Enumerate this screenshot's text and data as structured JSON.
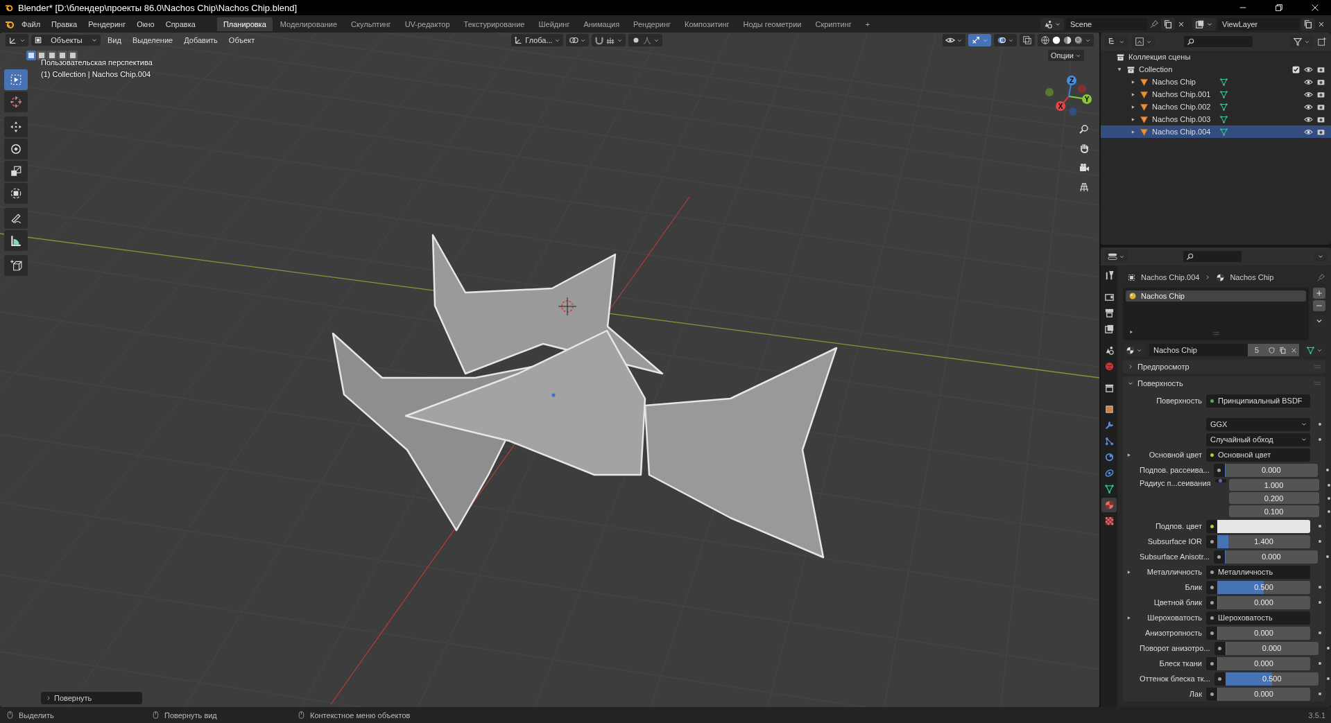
{
  "window": {
    "title": "Blender* [D:\\блендер\\проекты 86.0\\Nachos Chip\\Nachos Chip.blend]"
  },
  "menu_bar": {
    "menus": [
      "Файл",
      "Правка",
      "Рендеринг",
      "Окно",
      "Справка"
    ],
    "workspaces": [
      {
        "label": "Планировка",
        "selected": true
      },
      {
        "label": "Моделирование",
        "selected": false
      },
      {
        "label": "Скульптинг",
        "selected": false
      },
      {
        "label": "UV-редактор",
        "selected": false
      },
      {
        "label": "Текстурирование",
        "selected": false
      },
      {
        "label": "Шейдинг",
        "selected": false
      },
      {
        "label": "Анимация",
        "selected": false
      },
      {
        "label": "Рендеринг",
        "selected": false
      },
      {
        "label": "Композитинг",
        "selected": false
      },
      {
        "label": "Ноды геометрии",
        "selected": false
      },
      {
        "label": "Скриптинг",
        "selected": false
      }
    ],
    "add_tab": "+",
    "scene": "Scene",
    "view_layer": "ViewLayer"
  },
  "viewport_header": {
    "mode": "Объекты",
    "menus": [
      "Вид",
      "Выделение",
      "Добавить",
      "Объект"
    ],
    "orientation": "Глоба...",
    "options": "Опции",
    "select_modes": [
      {
        "selected": true
      },
      {
        "selected": false
      },
      {
        "selected": false
      },
      {
        "selected": false
      },
      {
        "selected": false
      }
    ]
  },
  "viewport": {
    "overlay_lines": [
      "Пользовательская перспектива",
      "(1) Collection | Nachos Chip.004"
    ],
    "tools": [
      {
        "kind": "select",
        "selected": true
      },
      {
        "kind": "cursor",
        "selected": false
      },
      {
        "kind": "move",
        "selected": false
      },
      {
        "kind": "rotate",
        "selected": false
      },
      {
        "kind": "scale",
        "selected": false
      },
      {
        "kind": "transform",
        "selected": false
      },
      {
        "kind": "annotate",
        "selected": false
      },
      {
        "kind": "measure",
        "selected": false
      },
      {
        "kind": "add_cube",
        "selected": false
      }
    ],
    "gizmo_axes": [
      "X",
      "Y",
      "Z"
    ],
    "last_operator": "Повернуть"
  },
  "outliner": {
    "root": "Коллекция сцены",
    "collections": [
      {
        "label": "Collection",
        "expanded": true,
        "checked": true,
        "children": [
          {
            "label": "Nachos Chip",
            "selected": false
          },
          {
            "label": "Nachos Chip.001",
            "selected": false
          },
          {
            "label": "Nachos Chip.002",
            "selected": false
          },
          {
            "label": "Nachos Chip.003",
            "selected": false
          },
          {
            "label": "Nachos Chip.004",
            "selected": true
          }
        ]
      }
    ]
  },
  "properties": {
    "tabs": [
      {
        "kind": "tool",
        "selected": false
      },
      {
        "kind": "render",
        "selected": false
      },
      {
        "kind": "output",
        "selected": false
      },
      {
        "kind": "view_layer",
        "selected": false
      },
      {
        "kind": "scene",
        "selected": false
      },
      {
        "kind": "world",
        "selected": false
      },
      {
        "kind": "collection",
        "selected": false
      },
      {
        "kind": "object",
        "selected": false
      },
      {
        "kind": "modifiers",
        "selected": false
      },
      {
        "kind": "particles",
        "selected": false
      },
      {
        "kind": "physics",
        "selected": false
      },
      {
        "kind": "constraints",
        "selected": false
      },
      {
        "kind": "data",
        "selected": false
      },
      {
        "kind": "material",
        "selected": true
      },
      {
        "kind": "texture",
        "selected": false
      }
    ],
    "breadcrumb": [
      "Nachos Chip.004",
      "Nachos Chip"
    ],
    "material_slots": [
      {
        "label": "Nachos Chip",
        "selected": true
      }
    ],
    "material": {
      "name": "Nachos Chip",
      "users": "5"
    },
    "panels": [
      {
        "label": "Предпросмотр",
        "expanded": false
      },
      {
        "label": "Поверхность",
        "expanded": true
      }
    ],
    "fields": [
      {
        "kind": "link",
        "label": "Поверхность",
        "value": "Принципиальный BSDF",
        "color": "#4cb04c"
      },
      {
        "kind": "dropdown",
        "value": "GGX"
      },
      {
        "kind": "dropdown",
        "value": "Случайный обход"
      },
      {
        "kind": "link",
        "label": "Основной цвет",
        "value": "Основной цвет",
        "color": "#c7c729",
        "expandable": true
      },
      {
        "kind": "slider",
        "label": "Подпов. рассеива...",
        "value": "0.000",
        "level": 0,
        "color": "#a1a1a1"
      },
      {
        "kind": "vector",
        "label": "Радиус п...сеивания",
        "values": [
          "1.000",
          "0.200",
          "0.100"
        ],
        "color": "#6363c7"
      },
      {
        "kind": "swatch",
        "label": "Подпов. цвет",
        "color": "#c7c729"
      },
      {
        "kind": "slider",
        "label": "Subsurface IOR",
        "value": "1.400",
        "level": 0.12,
        "color": "#a1a1a1"
      },
      {
        "kind": "slider",
        "label": "Subsurface Anisotr...",
        "value": "0.000",
        "level": 0,
        "color": "#a1a1a1"
      },
      {
        "kind": "link",
        "label": "Металличность",
        "value": "Металличность",
        "color": "#a1a1a1",
        "expandable": true
      },
      {
        "kind": "slider",
        "label": "Блик",
        "value": "0.500",
        "level": 0.5,
        "color": "#a1a1a1"
      },
      {
        "kind": "slider",
        "label": "Цветной блик",
        "value": "0.000",
        "level": 0,
        "color": "#a1a1a1"
      },
      {
        "kind": "link",
        "label": "Шероховатость",
        "value": "Шероховатость",
        "color": "#a1a1a1",
        "expandable": true
      },
      {
        "kind": "slider",
        "label": "Анизотропность",
        "value": "0.000",
        "level": 0,
        "color": "#a1a1a1"
      },
      {
        "kind": "slider",
        "label": "Поворот анизотро...",
        "value": "0.000",
        "level": 0,
        "color": "#a1a1a1"
      },
      {
        "kind": "slider",
        "label": "Блеск ткани",
        "value": "0.000",
        "level": 0,
        "color": "#a1a1a1"
      },
      {
        "kind": "slider",
        "label": "Оттенок блеска тк...",
        "value": "0.500",
        "level": 0.5,
        "color": "#a1a1a1"
      },
      {
        "kind": "slider",
        "label": "Лак",
        "value": "0.000",
        "level": 0,
        "color": "#a1a1a1"
      }
    ]
  },
  "status_bar": {
    "hints": [
      "Выделить",
      "Повернуть вид",
      "Контекстное меню объектов"
    ],
    "version": "3.5.1"
  }
}
